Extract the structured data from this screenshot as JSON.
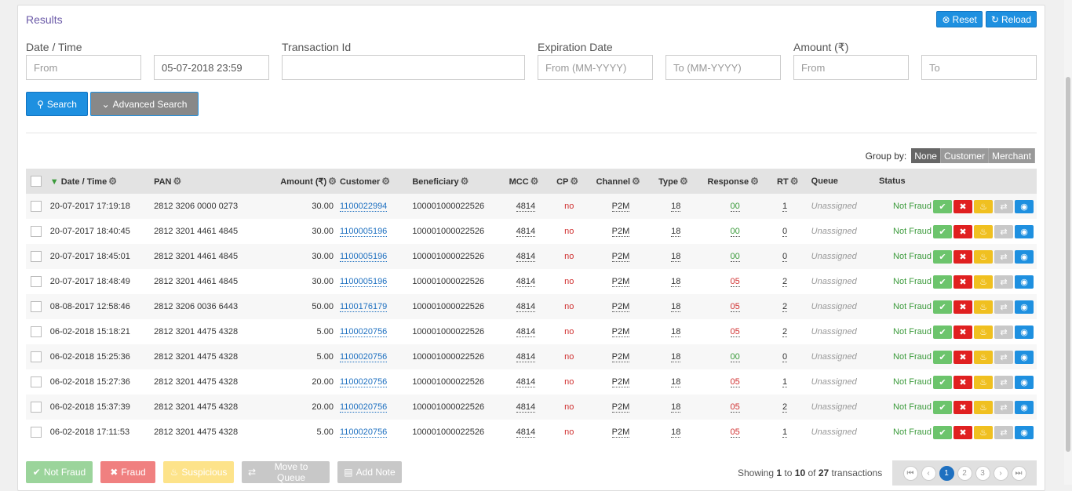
{
  "panel": {
    "title": "Results"
  },
  "header_buttons": {
    "reset": "Reset",
    "reload": "Reload"
  },
  "filters": {
    "date_label": "Date / Time",
    "date_from_placeholder": "From",
    "date_to_value": "05-07-2018 23:59",
    "txn_label": "Transaction Id",
    "exp_label": "Expiration Date",
    "exp_from_placeholder": "From (MM-YYYY)",
    "exp_to_placeholder": "To (MM-YYYY)",
    "amount_label": "Amount (₹)",
    "amount_from_placeholder": "From",
    "amount_to_placeholder": "To"
  },
  "search_buttons": {
    "search": "Search",
    "advanced": "Advanced Search"
  },
  "groupby": {
    "label": "Group by:",
    "options": [
      "None",
      "Customer",
      "Merchant"
    ],
    "selected": "None"
  },
  "columns": [
    "Date / Time",
    "PAN",
    "Amount (₹)",
    "Customer",
    "Beneficiary",
    "MCC",
    "CP",
    "Channel",
    "Type",
    "Response",
    "RT",
    "Queue",
    "Status"
  ],
  "rows": [
    {
      "date": "20-07-2017 17:19:18",
      "pan": "2812 3206 0000 0273",
      "amount": "30.00",
      "customer": "1100022994",
      "beneficiary": "100001000022526",
      "mcc": "4814",
      "cp": "no",
      "channel": "P2M",
      "type": "18",
      "response": "00",
      "rt": "1",
      "queue": "Unassigned",
      "status": "Not Fraud"
    },
    {
      "date": "20-07-2017 18:40:45",
      "pan": "2812 3201 4461 4845",
      "amount": "30.00",
      "customer": "1100005196",
      "beneficiary": "100001000022526",
      "mcc": "4814",
      "cp": "no",
      "channel": "P2M",
      "type": "18",
      "response": "00",
      "rt": "0",
      "queue": "Unassigned",
      "status": "Not Fraud"
    },
    {
      "date": "20-07-2017 18:45:01",
      "pan": "2812 3201 4461 4845",
      "amount": "30.00",
      "customer": "1100005196",
      "beneficiary": "100001000022526",
      "mcc": "4814",
      "cp": "no",
      "channel": "P2M",
      "type": "18",
      "response": "00",
      "rt": "0",
      "queue": "Unassigned",
      "status": "Not Fraud"
    },
    {
      "date": "20-07-2017 18:48:49",
      "pan": "2812 3201 4461 4845",
      "amount": "30.00",
      "customer": "1100005196",
      "beneficiary": "100001000022526",
      "mcc": "4814",
      "cp": "no",
      "channel": "P2M",
      "type": "18",
      "response": "05",
      "rt": "2",
      "queue": "Unassigned",
      "status": "Not Fraud"
    },
    {
      "date": "08-08-2017 12:58:46",
      "pan": "2812 3206 0036 6443",
      "amount": "50.00",
      "customer": "1100176179",
      "beneficiary": "100001000022526",
      "mcc": "4814",
      "cp": "no",
      "channel": "P2M",
      "type": "18",
      "response": "05",
      "rt": "2",
      "queue": "Unassigned",
      "status": "Not Fraud"
    },
    {
      "date": "06-02-2018 15:18:21",
      "pan": "2812 3201 4475 4328",
      "amount": "5.00",
      "customer": "1100020756",
      "beneficiary": "100001000022526",
      "mcc": "4814",
      "cp": "no",
      "channel": "P2M",
      "type": "18",
      "response": "05",
      "rt": "2",
      "queue": "Unassigned",
      "status": "Not Fraud"
    },
    {
      "date": "06-02-2018 15:25:36",
      "pan": "2812 3201 4475 4328",
      "amount": "5.00",
      "customer": "1100020756",
      "beneficiary": "100001000022526",
      "mcc": "4814",
      "cp": "no",
      "channel": "P2M",
      "type": "18",
      "response": "00",
      "rt": "0",
      "queue": "Unassigned",
      "status": "Not Fraud"
    },
    {
      "date": "06-02-2018 15:27:36",
      "pan": "2812 3201 4475 4328",
      "amount": "20.00",
      "customer": "1100020756",
      "beneficiary": "100001000022526",
      "mcc": "4814",
      "cp": "no",
      "channel": "P2M",
      "type": "18",
      "response": "05",
      "rt": "1",
      "queue": "Unassigned",
      "status": "Not Fraud"
    },
    {
      "date": "06-02-2018 15:37:39",
      "pan": "2812 3201 4475 4328",
      "amount": "20.00",
      "customer": "1100020756",
      "beneficiary": "100001000022526",
      "mcc": "4814",
      "cp": "no",
      "channel": "P2M",
      "type": "18",
      "response": "05",
      "rt": "2",
      "queue": "Unassigned",
      "status": "Not Fraud"
    },
    {
      "date": "06-02-2018 17:11:53",
      "pan": "2812 3201 4475 4328",
      "amount": "5.00",
      "customer": "1100020756",
      "beneficiary": "100001000022526",
      "mcc": "4814",
      "cp": "no",
      "channel": "P2M",
      "type": "18",
      "response": "05",
      "rt": "1",
      "queue": "Unassigned",
      "status": "Not Fraud"
    }
  ],
  "bulk_actions": {
    "not_fraud": "Not Fraud",
    "fraud": "Fraud",
    "suspicious": "Suspicious",
    "move_to_queue": "Move to Queue",
    "add_note": "Add Note"
  },
  "pagination": {
    "showing_prefix": "Showing",
    "from": "1",
    "to_word": "to",
    "to": "10",
    "of_word": "of",
    "total": "27",
    "suffix": "transactions",
    "pages": [
      "1",
      "2",
      "3"
    ],
    "current": "1"
  }
}
